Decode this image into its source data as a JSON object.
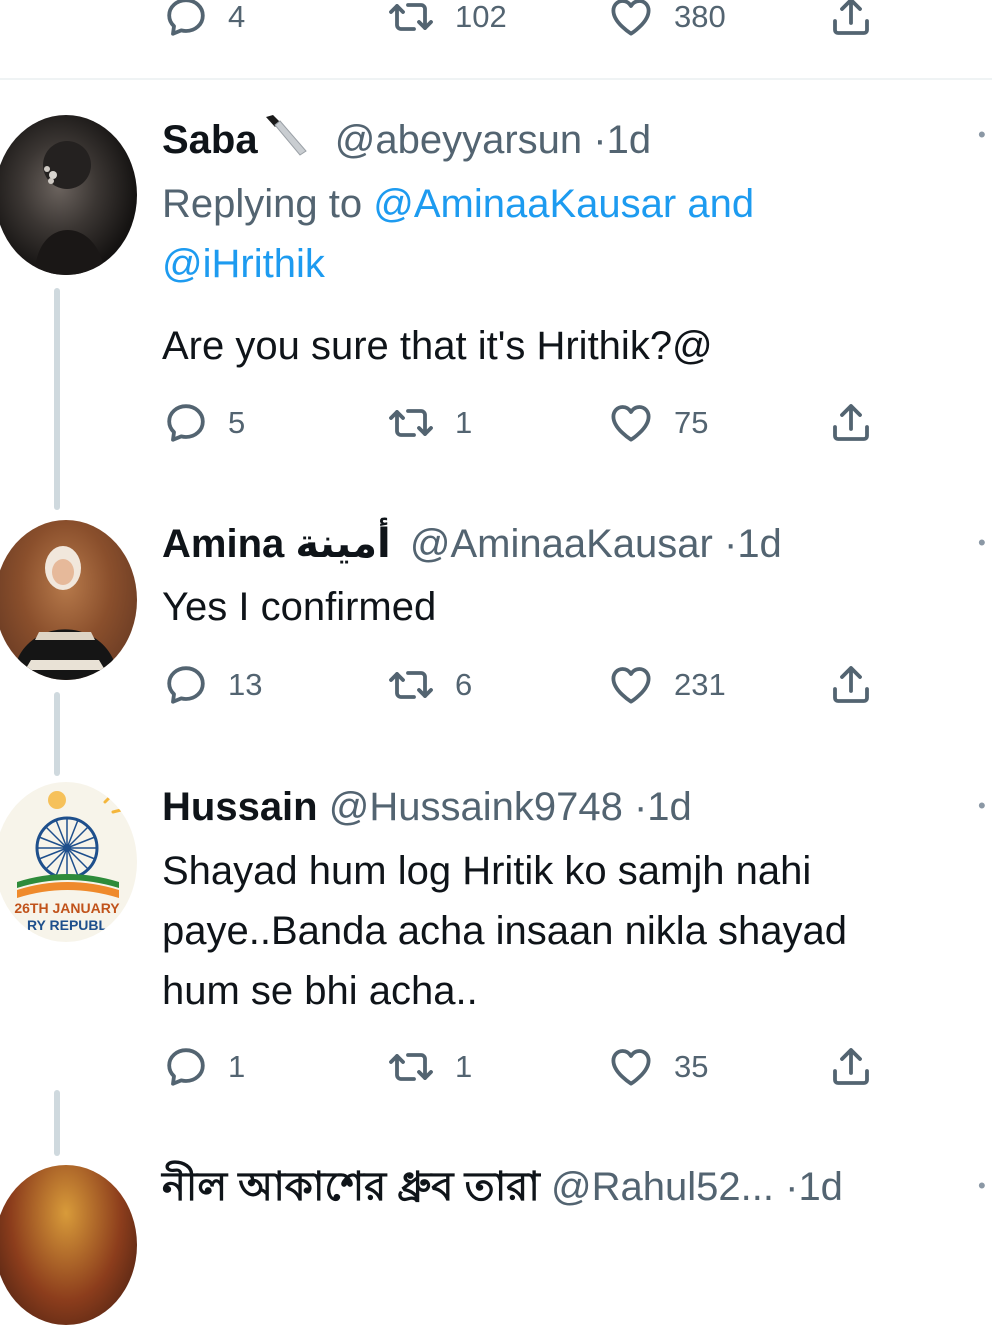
{
  "top_actions": {
    "replies": "4",
    "retweets": "102",
    "likes": "380"
  },
  "tweets": [
    {
      "name": "Saba",
      "handle": "@abeyyarsun",
      "sep": "·",
      "time": "1d",
      "replying_prefix": "Replying to",
      "replying_users": "@AminaaKausar and",
      "replying_users_2": "@iHrithik",
      "text": "Are you sure that it's Hrithik?@",
      "replies": "5",
      "retweets": "1",
      "likes": "75"
    },
    {
      "name": "Amina",
      "name_arabic": "أمينة",
      "handle": "@AminaaKausar",
      "sep": "·",
      "time": "1d",
      "text": "Yes I confirmed",
      "replies": "13",
      "retweets": "6",
      "likes": "231"
    },
    {
      "name": "Hussain",
      "handle": "@Hussaink9748",
      "sep": "·",
      "time": "1d",
      "text_lines": [
        "Shayad hum log Hritik ko samjh nahi",
        "paye..Banda acha insaan nikla shayad",
        "hum se bhi acha.."
      ],
      "avatar_text_1": "26TH JANUARY",
      "avatar_text_2": "RY REPUBL",
      "replies": "1",
      "retweets": "1",
      "likes": "35"
    },
    {
      "name": "নীল আকাশের ধ্রুব তারা",
      "handle": "@Rahul52...",
      "sep": "·",
      "time": "1d"
    }
  ],
  "icons": {
    "reply": "reply-icon",
    "retweet": "retweet-icon",
    "like": "heart-icon",
    "share": "share-icon",
    "more": "more-icon",
    "knife": "knife-emoji-icon"
  },
  "colors": {
    "link": "#1d9bf0",
    "secondary": "#536471",
    "text": "#0f1419",
    "thread_line": "#cfd9de"
  }
}
